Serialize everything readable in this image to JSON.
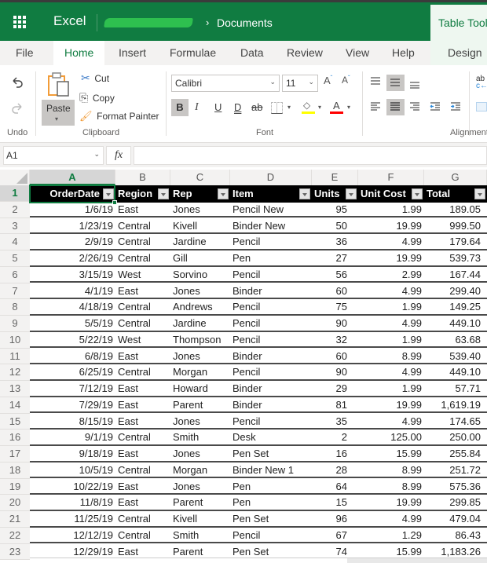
{
  "titlebar": {
    "app_name": "Excel",
    "breadcrumb_separator": "›",
    "breadcrumb_folder": "Documents",
    "contextual_tab_group": "Table Tools",
    "user_name_redacted": true
  },
  "tabs": [
    {
      "label": "File",
      "active": false
    },
    {
      "label": "Home",
      "active": true
    },
    {
      "label": "Insert",
      "active": false
    },
    {
      "label": "Formulae",
      "active": false
    },
    {
      "label": "Data",
      "active": false
    },
    {
      "label": "Review",
      "active": false
    },
    {
      "label": "View",
      "active": false
    },
    {
      "label": "Help",
      "active": false
    },
    {
      "label": "Design",
      "active": false,
      "contextual": true
    }
  ],
  "ribbon": {
    "undo_group": {
      "label": "Undo",
      "undo_icon": "undo-icon",
      "redo_icon": "redo-icon"
    },
    "clipboard_group": {
      "label": "Clipboard",
      "paste": "Paste",
      "cut": "Cut",
      "copy": "Copy",
      "format_painter": "Format Painter"
    },
    "font_group": {
      "label": "Font",
      "font_name": "Calibri",
      "font_size": "11",
      "grow_font": "A",
      "shrink_font": "A",
      "bold": "B",
      "italic": "I",
      "underline": "U",
      "double_underline": "D",
      "strikethrough": "ab",
      "font_color_label": "A",
      "highlight_color": "#ffff00",
      "font_color": "#ff0000",
      "bold_active": true
    },
    "alignment_group": {
      "label": "Alignment",
      "middle_align_active": true,
      "center_align_active": true
    }
  },
  "formula_bar": {
    "name_box": "A1",
    "fx_label": "fx",
    "formula": ""
  },
  "grid": {
    "selected_cell": "A1",
    "columns": [
      "A",
      "B",
      "C",
      "D",
      "E",
      "F",
      "G"
    ],
    "row_numbers": [
      "1",
      "2",
      "3",
      "4",
      "5",
      "6",
      "7",
      "8",
      "9",
      "10",
      "11",
      "12",
      "13",
      "14",
      "15",
      "16",
      "17",
      "18",
      "19",
      "20",
      "21",
      "22",
      "23"
    ],
    "table_headers": [
      "OrderDate",
      "Region",
      "Rep",
      "Item",
      "Units",
      "Unit Cost",
      "Total"
    ],
    "rows": [
      [
        "1/6/19",
        "East",
        "Jones",
        "Pencil New",
        "95",
        "1.99",
        "189.05"
      ],
      [
        "1/23/19",
        "Central",
        "Kivell",
        "Binder New",
        "50",
        "19.99",
        "999.50"
      ],
      [
        "2/9/19",
        "Central",
        "Jardine",
        "Pencil",
        "36",
        "4.99",
        "179.64"
      ],
      [
        "2/26/19",
        "Central",
        "Gill",
        "Pen",
        "27",
        "19.99",
        "539.73"
      ],
      [
        "3/15/19",
        "West",
        "Sorvino",
        "Pencil",
        "56",
        "2.99",
        "167.44"
      ],
      [
        "4/1/19",
        "East",
        "Jones",
        "Binder",
        "60",
        "4.99",
        "299.40"
      ],
      [
        "4/18/19",
        "Central",
        "Andrews",
        "Pencil",
        "75",
        "1.99",
        "149.25"
      ],
      [
        "5/5/19",
        "Central",
        "Jardine",
        "Pencil",
        "90",
        "4.99",
        "449.10"
      ],
      [
        "5/22/19",
        "West",
        "Thompson",
        "Pencil",
        "32",
        "1.99",
        "63.68"
      ],
      [
        "6/8/19",
        "East",
        "Jones",
        "Binder",
        "60",
        "8.99",
        "539.40"
      ],
      [
        "6/25/19",
        "Central",
        "Morgan",
        "Pencil",
        "90",
        "4.99",
        "449.10"
      ],
      [
        "7/12/19",
        "East",
        "Howard",
        "Binder",
        "29",
        "1.99",
        "57.71"
      ],
      [
        "7/29/19",
        "East",
        "Parent",
        "Binder",
        "81",
        "19.99",
        "1,619.19"
      ],
      [
        "8/15/19",
        "East",
        "Jones",
        "Pencil",
        "35",
        "4.99",
        "174.65"
      ],
      [
        "9/1/19",
        "Central",
        "Smith",
        "Desk",
        "2",
        "125.00",
        "250.00"
      ],
      [
        "9/18/19",
        "East",
        "Jones",
        "Pen Set",
        "16",
        "15.99",
        "255.84"
      ],
      [
        "10/5/19",
        "Central",
        "Morgan",
        "Binder New 1",
        "28",
        "8.99",
        "251.72"
      ],
      [
        "10/22/19",
        "East",
        "Jones",
        "Pen",
        "64",
        "8.99",
        "575.36"
      ],
      [
        "11/8/19",
        "East",
        "Parent",
        "Pen",
        "15",
        "19.99",
        "299.85"
      ],
      [
        "11/25/19",
        "Central",
        "Kivell",
        "Pen Set",
        "96",
        "4.99",
        "479.04"
      ],
      [
        "12/12/19",
        "Central",
        "Smith",
        "Pencil",
        "67",
        "1.29",
        "86.43"
      ],
      [
        "12/29/19",
        "East",
        "Parent",
        "Pen Set",
        "74",
        "15.99",
        "1,183.26"
      ]
    ]
  },
  "colors": {
    "brand_green": "#107c41",
    "table_header_bg": "#000000",
    "table_header_text": "#ffffff"
  }
}
